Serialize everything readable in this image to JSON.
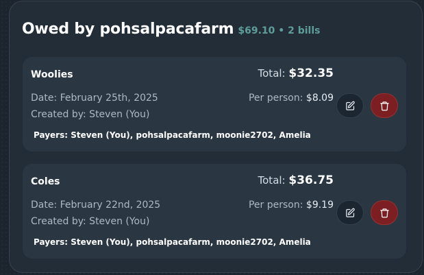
{
  "header": {
    "title": "Owed by pohsalpacafarm",
    "summary": "$69.10 • 2 bills"
  },
  "bills": [
    {
      "name": "Woolies",
      "total_label": "Total:",
      "total_value": "$32.35",
      "date": "Date: February 25th, 2025",
      "created_by": "Created by: Steven (You)",
      "per_person_label": "Per person:",
      "per_person_value": "$8.09",
      "payers_label": "Payers:",
      "payers": "Steven (You), pohsalpacafarm, moonie2702, Amelia",
      "edit_icon": "edit-icon",
      "delete_icon": "trash-icon"
    },
    {
      "name": "Coles",
      "total_label": "Total:",
      "total_value": "$36.75",
      "date": "Date: February 22nd, 2025",
      "created_by": "Created by: Steven (You)",
      "per_person_label": "Per person:",
      "per_person_value": "$9.19",
      "payers_label": "Payers:",
      "payers": "Steven (You), pohsalpacafarm, moonie2702, Amelia",
      "edit_icon": "edit-icon",
      "delete_icon": "trash-icon"
    }
  ],
  "colors": {
    "accent_teal": "#5f9e98",
    "delete_red": "#7b1f22",
    "card_bg": "#2a3743"
  }
}
